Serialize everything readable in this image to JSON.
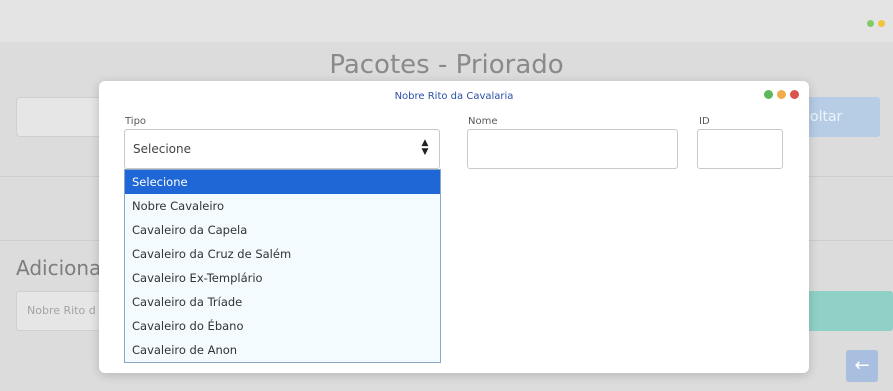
{
  "background": {
    "page_title": "Pacotes - Priorado",
    "voltar_label": "oltar",
    "section_heading": "Adicionar",
    "input_placeholder": "Nobre Rito d",
    "back_arrow": "←",
    "window_dots": [
      "#7fcc66",
      "#f0c43c"
    ]
  },
  "modal": {
    "title": "Nobre Rito da Cavalaria",
    "window_dots": [
      "#5cb85c",
      "#f0ad4e",
      "#d9534f"
    ],
    "fields": {
      "tipo_label": "Tipo",
      "nome_label": "Nome",
      "id_label": "ID",
      "tipo_value": "Selecione",
      "nome_value": "",
      "id_value": ""
    },
    "dropdown": {
      "selected_index": 0,
      "options": [
        "Selecione",
        "Nobre Cavaleiro",
        "Cavaleiro da Capela",
        "Cavaleiro da Cruz de Salém",
        "Cavaleiro Ex-Templário",
        "Cavaleiro da Tríade",
        "Cavaleiro do Ébano",
        "Cavaleiro de Anon"
      ]
    }
  },
  "colors": {
    "selected_option_bg": "#1f67d6",
    "modal_title": "#2b4fa8"
  }
}
